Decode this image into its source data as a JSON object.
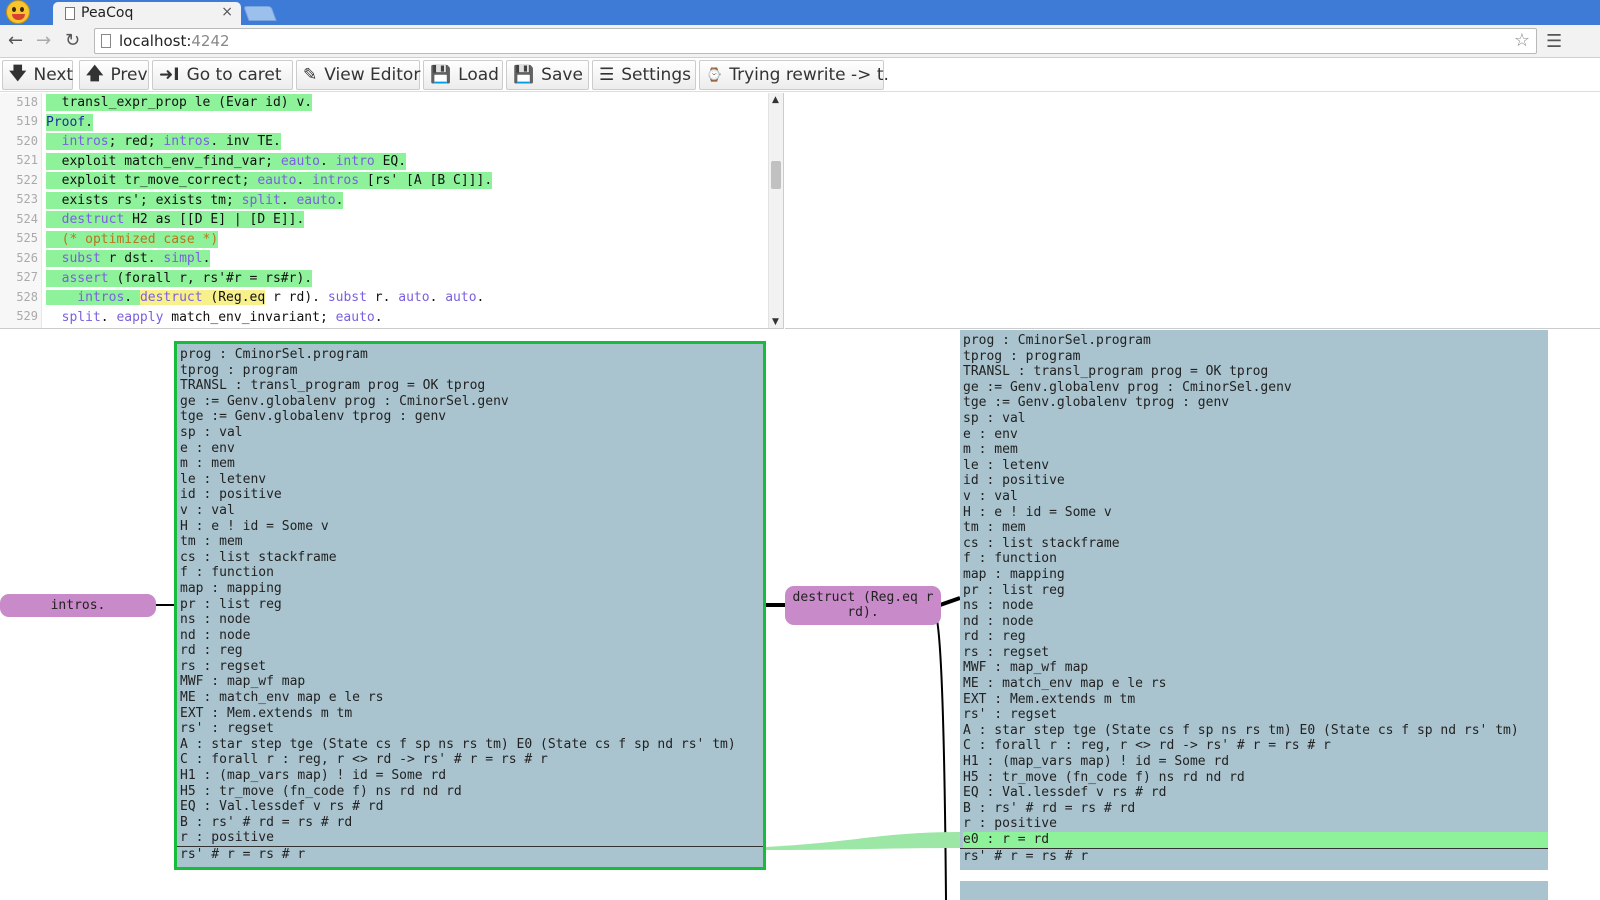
{
  "browser": {
    "tab_title": "PeaCoq",
    "tab_close": "×",
    "url_host": "localhost:",
    "url_port": "4242",
    "icons": [
      "back-icon",
      "forward-icon",
      "reload-icon",
      "star-icon",
      "menu-icon",
      "page-icon"
    ]
  },
  "toolbar": {
    "next": "Next",
    "prev": "Prev",
    "go_to_caret": "Go to caret",
    "view_editor": "View Editor",
    "load": "Load",
    "save": "Save",
    "settings": "Settings",
    "trying": "Trying rewrite -> t."
  },
  "editor": {
    "lines": [
      {
        "n": "518",
        "text": "  transl_expr_prop le (Evar id) v."
      },
      {
        "n": "519",
        "text": "Proof."
      },
      {
        "n": "520",
        "text": "  intros; red; intros. inv TE."
      },
      {
        "n": "521",
        "text": "  exploit match_env_find_var; eauto. intro EQ."
      },
      {
        "n": "522",
        "text": "  exploit tr_move_correct; eauto. intros [rs' [A [B C]]]."
      },
      {
        "n": "523",
        "text": "  exists rs'; exists tm; split. eauto."
      },
      {
        "n": "524",
        "text": "  destruct H2 as [[D E] | [D E]]."
      },
      {
        "n": "525",
        "text": "  (* optimized case *)"
      },
      {
        "n": "526",
        "text": "  subst r dst. simpl."
      },
      {
        "n": "527",
        "text": "  assert (forall r, rs'#r = rs#r)."
      },
      {
        "n": "528",
        "text": "    intros. destruct (Reg.eq r rd). subst r. auto. auto."
      },
      {
        "n": "529",
        "text": "  split. eapply match_env_invariant; eauto."
      }
    ]
  },
  "tree": {
    "tactic_left": "intros.",
    "tactic_mid": "destruct (Reg.eq r\nrd).",
    "goal_left": {
      "hyps": [
        "prog : CminorSel.program",
        "tprog : program",
        "TRANSL : transl_program prog = OK tprog",
        "ge := Genv.globalenv prog : CminorSel.genv",
        "tge := Genv.globalenv tprog : genv",
        "sp : val",
        "e : env",
        "m : mem",
        "le : letenv",
        "id : positive",
        "v : val",
        "H : e ! id = Some v",
        "tm : mem",
        "cs : list stackframe",
        "f : function",
        "map : mapping",
        "pr : list reg",
        "ns : node",
        "nd : node",
        "rd : reg",
        "rs : regset",
        "MWF : map_wf map",
        "ME : match_env map e le rs",
        "EXT : Mem.extends m tm",
        "rs' : regset",
        "A : star step tge (State cs f sp ns rs tm) E0 (State cs f sp nd rs' tm)",
        "C : forall r : reg, r <> rd -> rs' # r = rs # r",
        "H1 : (map_vars map) ! id = Some rd",
        "H5 : tr_move (fn_code f) ns rd nd rd",
        "EQ : Val.lessdef v rs # rd",
        "B : rs' # rd = rs # rd",
        "r : positive"
      ],
      "conclusion": "rs' # r = rs # r"
    },
    "goal_right": {
      "hyps": [
        "prog : CminorSel.program",
        "tprog : program",
        "TRANSL : transl_program prog = OK tprog",
        "ge := Genv.globalenv prog : CminorSel.genv",
        "tge := Genv.globalenv tprog : genv",
        "sp : val",
        "e : env",
        "m : mem",
        "le : letenv",
        "id : positive",
        "v : val",
        "H : e ! id = Some v",
        "tm : mem",
        "cs : list stackframe",
        "f : function",
        "map : mapping",
        "pr : list reg",
        "ns : node",
        "nd : node",
        "rd : reg",
        "rs : regset",
        "MWF : map_wf map",
        "ME : match_env map e le rs",
        "EXT : Mem.extends m tm",
        "rs' : regset",
        "A : star step tge (State cs f sp ns rs tm) E0 (State cs f sp nd rs' tm)",
        "C : forall r : reg, r <> rd -> rs' # r = rs # r",
        "H1 : (map_vars map) ! id = Some rd",
        "H5 : tr_move (fn_code f) ns rd nd rd",
        "EQ : Val.lessdef v rs # rd",
        "B : rs' # rd = rs # rd",
        "r : positive",
        "e0 : r = rd"
      ],
      "conclusion": "rs' # r = rs # r"
    }
  },
  "colors": {
    "processed": "#8ef29b",
    "tactic": "#c88ac8",
    "goal": "#a9c4cf",
    "focus_border": "#17bc3a",
    "tab_bar": "#3d7bd6"
  }
}
